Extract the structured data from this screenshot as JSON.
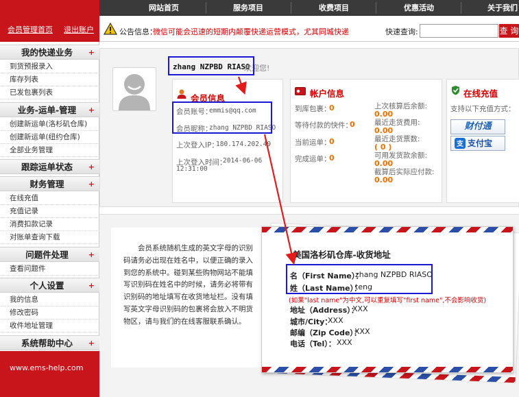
{
  "nav": {
    "items": [
      "网站首页",
      "服务项目",
      "收费项目",
      "优惠活动",
      "关于我们"
    ]
  },
  "sidebar": {
    "top_links": [
      "会员管理首页",
      "退出账户"
    ],
    "sections": [
      {
        "title": "我的快递业务",
        "items": [
          "到货预报录入",
          "库存列表",
          "已发包裹列表"
        ]
      },
      {
        "title": "业务-运单-管理",
        "items": [
          "创建新运单(洛杉矶仓库)",
          "创建新运单(纽约仓库)",
          "全部业务管理"
        ]
      },
      {
        "title": "跟踪运单状态",
        "items": []
      },
      {
        "title": "财务管理",
        "items": [
          "在线充值",
          "充值记录",
          "消费扣款记录",
          "对账单查询下载"
        ]
      },
      {
        "title": "问题件处理",
        "items": [
          "查看问题件"
        ]
      },
      {
        "title": "个人设置",
        "items": [
          "我的信息",
          "修改密码",
          "收件地址管理"
        ]
      },
      {
        "title": "系统帮助中心",
        "items": []
      }
    ],
    "footer_url": "www.ems-help.com"
  },
  "notice": {
    "label": "公告信息：",
    "text": "微信可能会迅速的短期内颠覆快递运营模式，尤其同城快递",
    "search_label": "快速查询:",
    "search_value": "",
    "search_button": "查 询"
  },
  "welcome": {
    "username": "zhang NZPBD RIASO",
    "greeting": "欢迎您!"
  },
  "member_info": {
    "title": "会员信息",
    "account_label": "会员账号：",
    "account_value": "emmis@qq.com",
    "nickname_label": "会员昵称：",
    "nickname_value": "zhang NZPBD RIASO",
    "last_ip_label": "上次登入IP：",
    "last_ip_value": "180.174.202.49",
    "last_time_label": "上次登入时间：",
    "last_time_value": "2014-06-06",
    "last_time_clock": "12:31:00"
  },
  "account_info": {
    "title": "帐户信息",
    "left": [
      {
        "label": "到库包裹：",
        "value": "0"
      },
      {
        "label": "等待付款的快件：",
        "value": "0"
      },
      {
        "label": "当前运单：",
        "value": "0"
      },
      {
        "label": "完成运单：",
        "value": "0"
      }
    ],
    "right": [
      {
        "label": "上次核算后余额:",
        "value": "0.00"
      },
      {
        "label": "最近走货费用:",
        "value": "0.00"
      },
      {
        "label": "最近走货票数:",
        "value": "( 0 )"
      },
      {
        "label": "可用发货款余额:",
        "value": "0.00"
      },
      {
        "label": "截算后实际应付款:",
        "value": "0.00"
      }
    ]
  },
  "recharge": {
    "title": "在线充值",
    "subtitle": "支持以下充值方式：",
    "methods": [
      "财付通",
      "支付宝"
    ]
  },
  "description": "会员系统随机生成的英文字母的识别码请务必出现在姓名中，以便正确的录入到您的系统中。碰到某些购物网站不能填写识别码在姓名中的时候，请务必将带有识别码的地址填写在收货地址栏。没有填写英文字母识别码的包裹将会放入不明货物区，请与我们的在线客服联系确认。",
  "envelope": {
    "title": "美国洛杉矶仓库-收货地址",
    "first_name_label": "名（First Name）：",
    "first_name_value": "zhang NZPBD RIASO",
    "last_name_label": "姓（Last Name）：",
    "last_name_value": "teng",
    "note": "(如果\"last name\"为中文,可以重复填写\"first name\",不会影响收货)",
    "address_label": "地址（Address）：",
    "address_value": "XXX",
    "city_label": "城市/City：",
    "city_value": "XXX",
    "zip_label": "邮编（Zip Code）：",
    "zip_value": "XXX",
    "tel_label": "电话（Tel）：",
    "tel_value": "XXX"
  },
  "colors": {
    "brand_red": "#c8151b",
    "highlight_blue": "#1a1ad6",
    "value_orange": "#f07000"
  }
}
